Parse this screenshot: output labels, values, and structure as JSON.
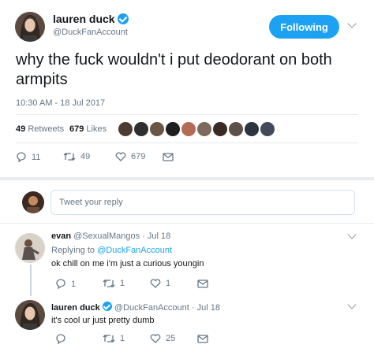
{
  "tweet": {
    "author_name": "lauren duck",
    "author_handle": "@DuckFanAccount",
    "follow_label": "Following",
    "text": "why the fuck wouldn't i put deodorant on both armpits",
    "timestamp": "10:30 AM - 18 Jul 2017",
    "retweets_count": "49",
    "retweets_label": "Retweets",
    "likes_count": "679",
    "likes_label": "Likes",
    "actions": {
      "replies": "11",
      "retweets": "49",
      "likes": "679"
    }
  },
  "reply_box": {
    "placeholder": "Tweet your reply"
  },
  "replies": [
    {
      "author_name": "evan",
      "author_handle": "@SexualMangos",
      "date": "· Jul 18",
      "replying_prefix": "Replying to",
      "replying_to": "@DuckFanAccount",
      "text": "ok chill on me i'm just a curious youngin",
      "actions": {
        "replies": "1",
        "retweets": "1",
        "likes": "1"
      }
    },
    {
      "author_name": "lauren duck",
      "author_handle": "@DuckFanAccount",
      "date": "· Jul 18",
      "text": "it's cool ur just pretty dumb",
      "actions": {
        "replies": "",
        "retweets": "1",
        "likes": "25"
      }
    }
  ],
  "colors": {
    "accent": "#1da1f2",
    "muted": "#657786",
    "divider": "#e6ecf0"
  }
}
